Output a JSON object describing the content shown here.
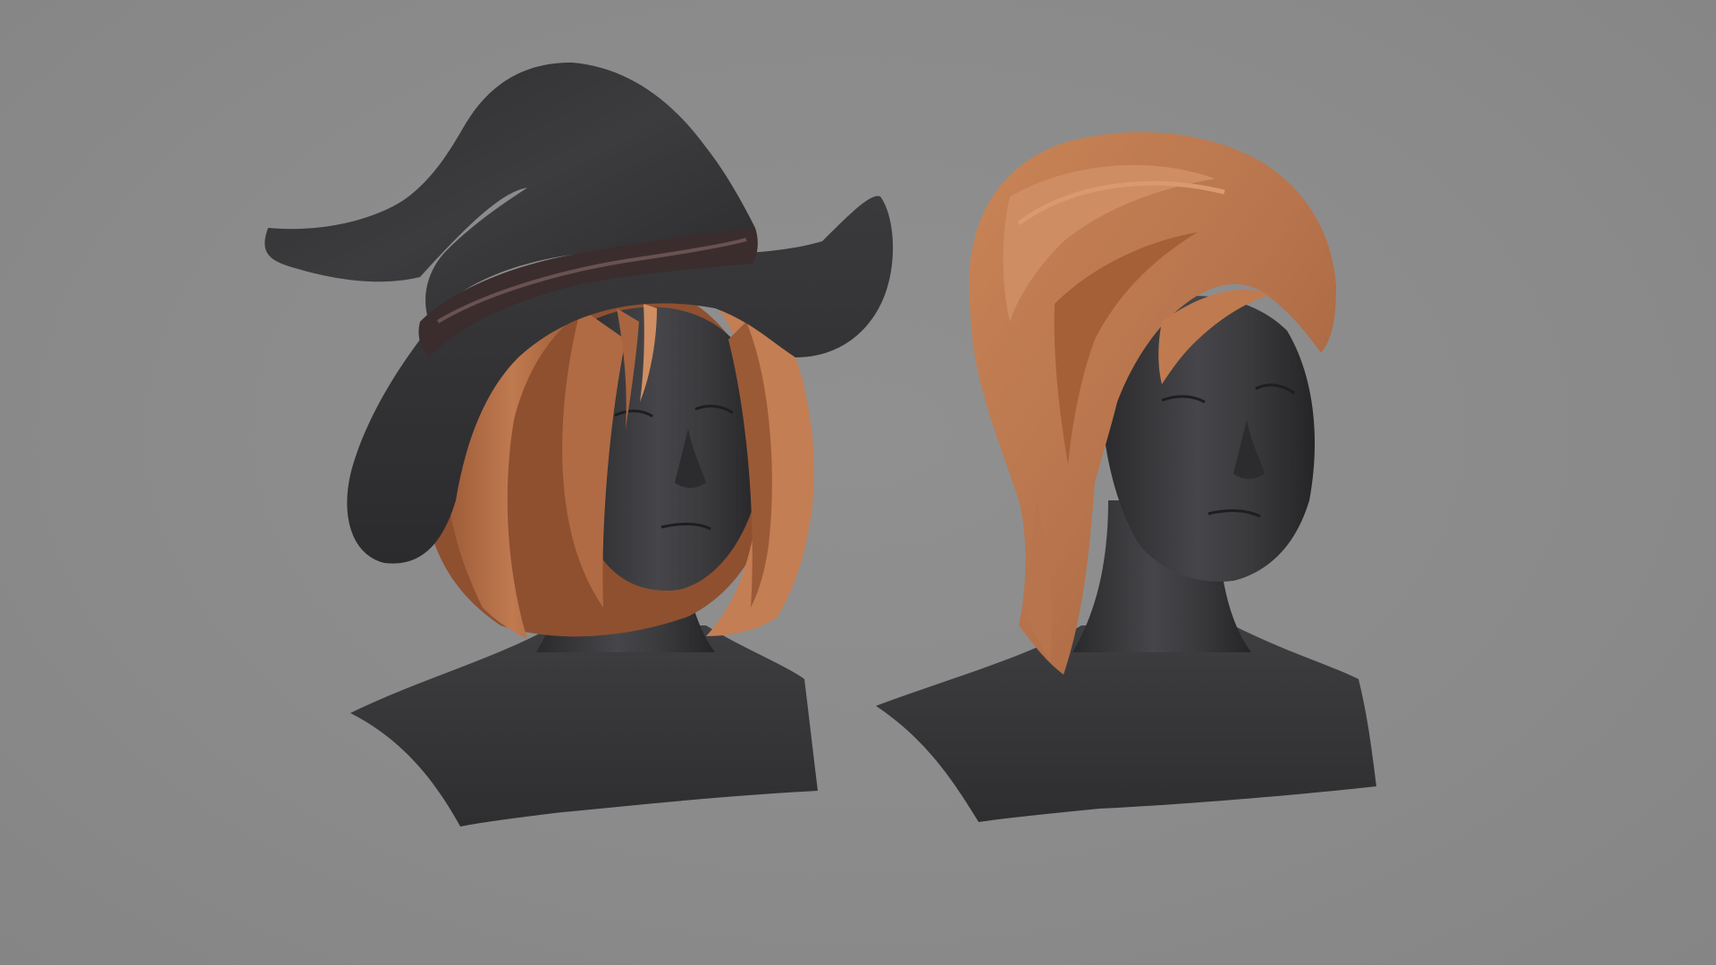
{
  "scene": {
    "background_color": "#8a8a8a",
    "colors": {
      "skin": "#3a3a3c",
      "skin_highlight": "#58585b",
      "skin_shadow": "#222224",
      "hat": "#333335",
      "hat_highlight": "#4a4a4d",
      "hat_band": "#3b2d2d",
      "hair": "#b5714a",
      "hair_highlight": "#cf8d63",
      "hair_shadow": "#8a4f2f"
    },
    "models": [
      {
        "id": "witch-hat-bob",
        "hat": "witch-hat-icon",
        "hair": "short-bob-hair-icon"
      },
      {
        "id": "side-swept",
        "hat": "",
        "hair": "side-swept-hair-icon"
      }
    ]
  }
}
